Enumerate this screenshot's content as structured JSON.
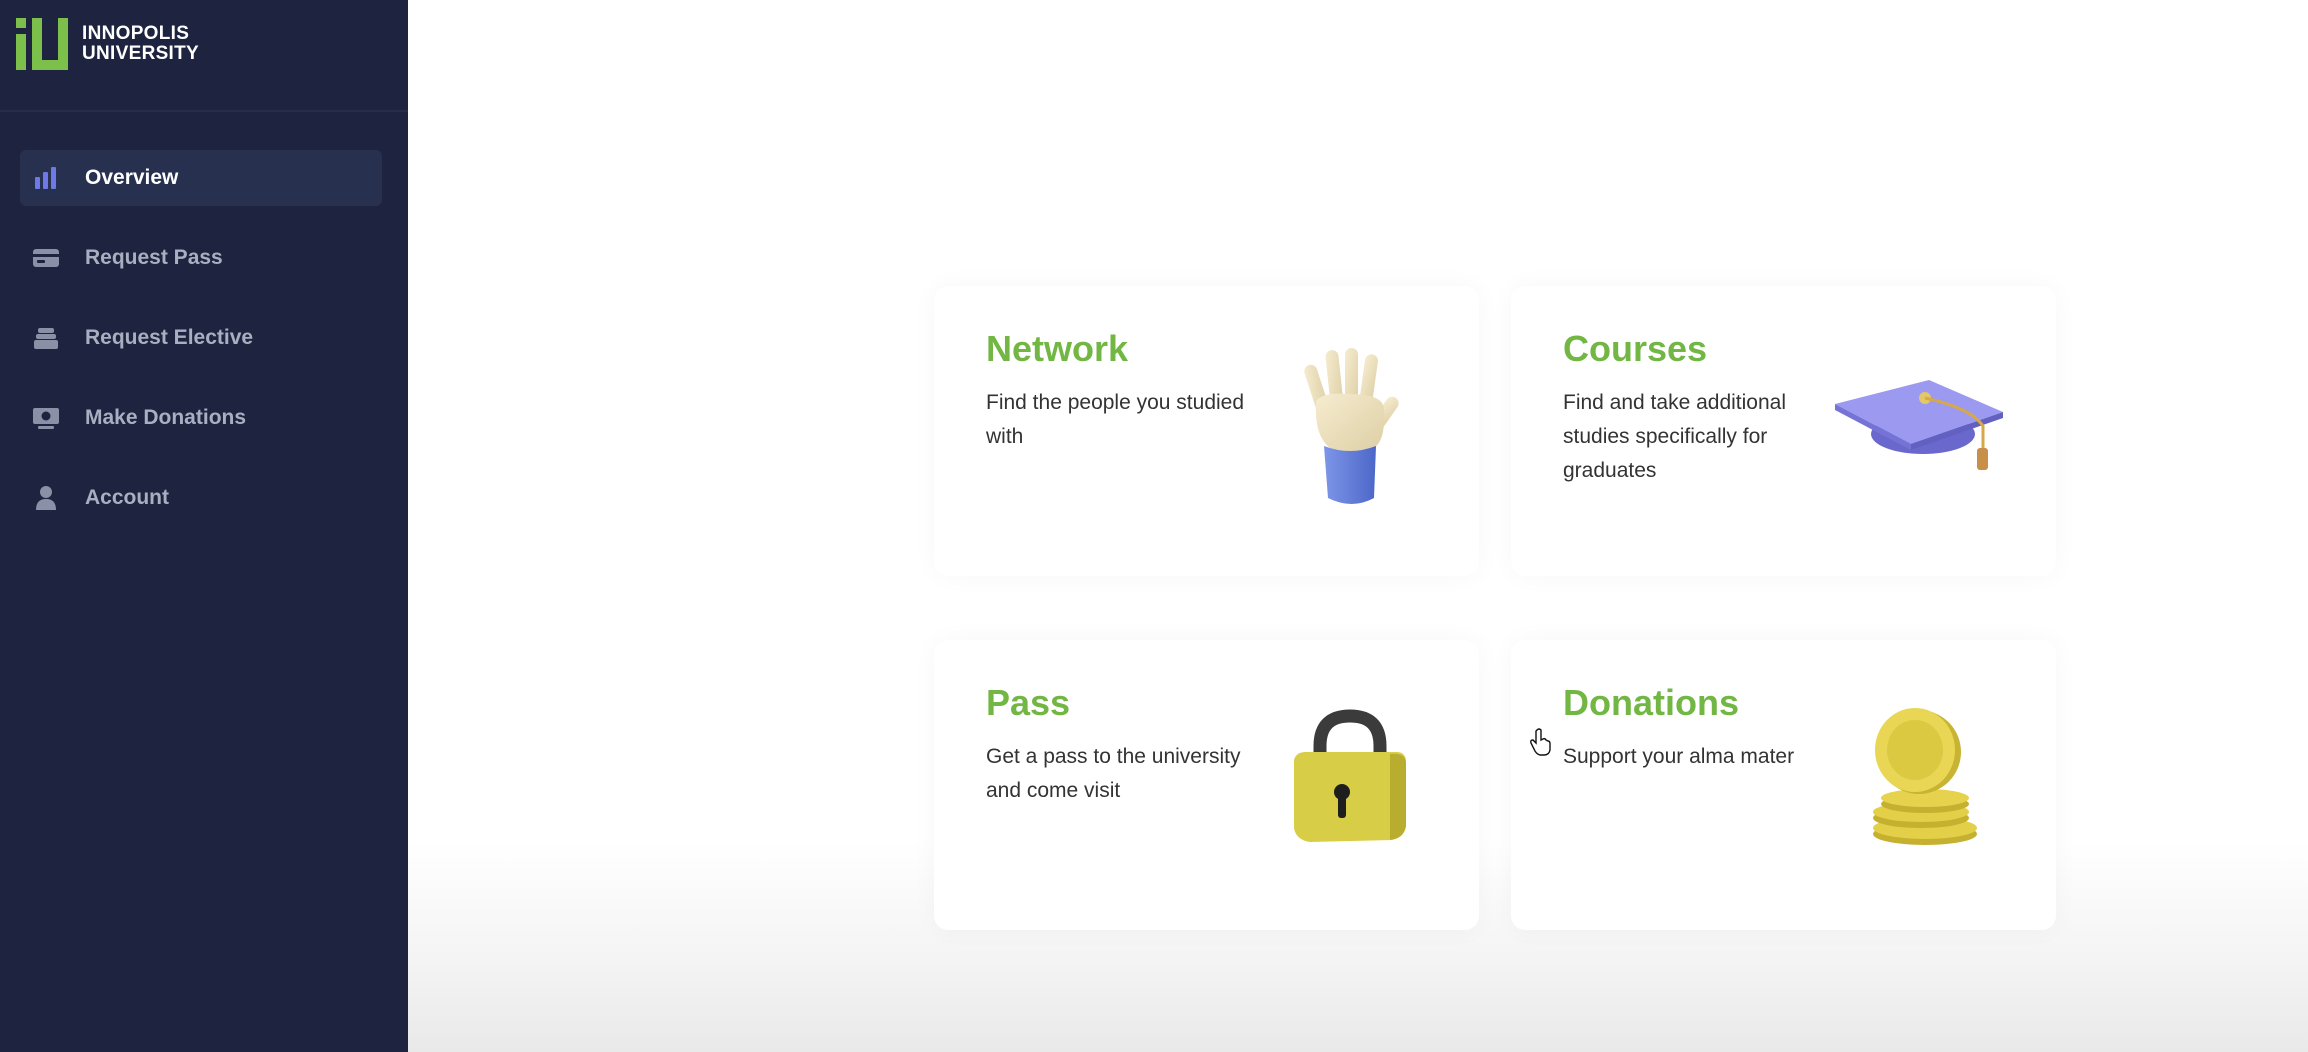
{
  "brand": {
    "line1": "INNOPOLIS",
    "line2": "UNIVERSITY",
    "color": "#7cc04b"
  },
  "sidebar": {
    "background": "#1e2440",
    "items": [
      {
        "label": "Overview",
        "icon": "bar-chart-icon",
        "active": true
      },
      {
        "label": "Request Pass",
        "icon": "card-icon",
        "active": false
      },
      {
        "label": "Request Elective",
        "icon": "stack-icon",
        "active": false
      },
      {
        "label": "Make Donations",
        "icon": "banknote-icon",
        "active": false
      },
      {
        "label": "Account",
        "icon": "user-icon",
        "active": false
      }
    ]
  },
  "cards": [
    {
      "title": "Network",
      "description": "Find the people you studied with",
      "image": "waving-hand-image"
    },
    {
      "title": "Courses",
      "description": "Find and take additional studies specifically for graduates",
      "image": "graduation-cap-image"
    },
    {
      "title": "Pass",
      "description": "Get a pass to the university and come visit",
      "image": "padlock-image"
    },
    {
      "title": "Donations",
      "description": "Support your alma mater",
      "image": "coins-image"
    }
  ],
  "accent": "#72b644"
}
